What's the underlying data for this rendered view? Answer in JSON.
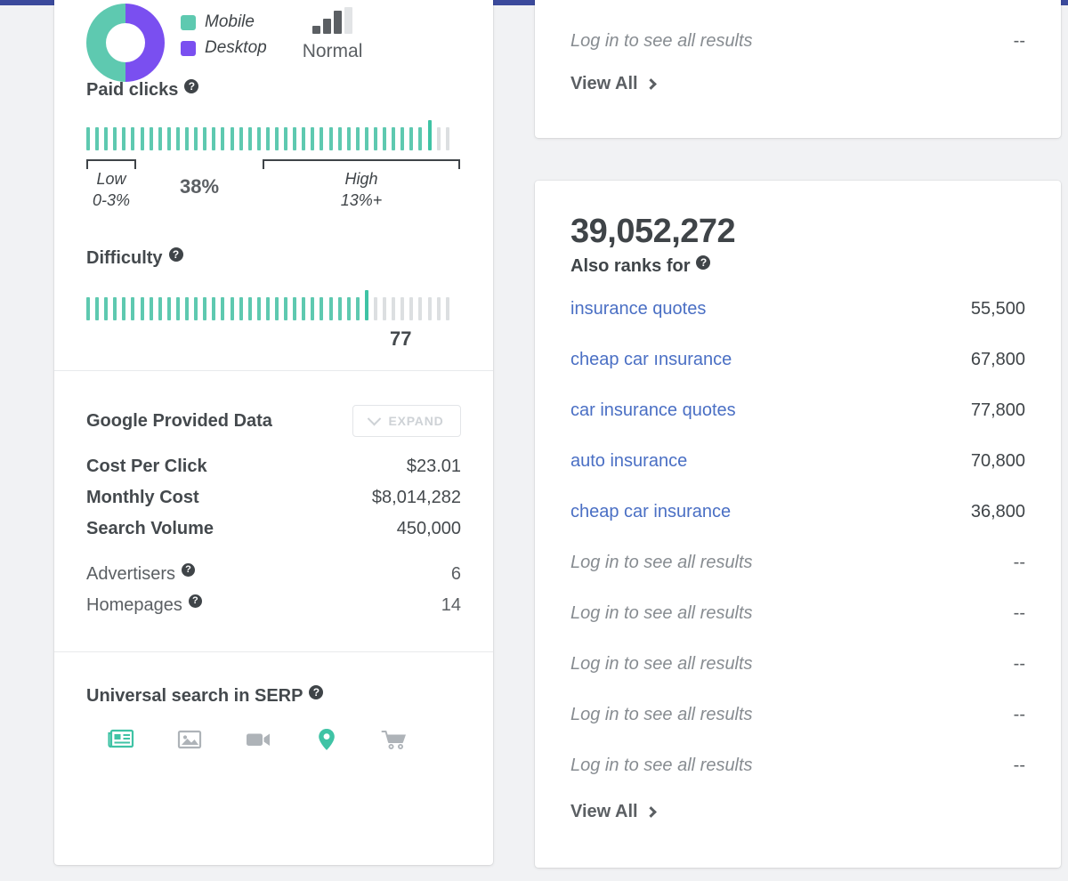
{
  "theme": {
    "topbar_color": "#3b4a9c",
    "accent_teal": "#5ec9b0",
    "accent_purple": "#7a4ff0",
    "link_blue": "#4a6fc4",
    "page_bg": "#f1f2f4"
  },
  "device_split": {
    "legend": [
      {
        "label": "Mobile",
        "color": "#5ec9b0",
        "percent": 50
      },
      {
        "label": "Desktop",
        "color": "#7a4ff0",
        "percent": 50
      }
    ]
  },
  "competition": {
    "label": "Normal",
    "bars_total": 4,
    "bars_filled": 3
  },
  "paid_clicks": {
    "title": "Paid clicks",
    "value": "38%",
    "ticks_total": 41,
    "ticks_filled": 38,
    "low": {
      "label": "Low",
      "range": "0-3%"
    },
    "high": {
      "label": "High",
      "range": "13%+"
    }
  },
  "difficulty": {
    "title": "Difficulty",
    "value": "77",
    "ticks_total": 41,
    "ticks_filled": 31
  },
  "google_provided_data": {
    "title": "Google Provided Data",
    "expand_label": "EXPAND",
    "rows": [
      {
        "key": "Cost Per Click",
        "value": "$23.01"
      },
      {
        "key": "Monthly Cost",
        "value": "$8,014,282"
      },
      {
        "key": "Search Volume",
        "value": "450,000"
      }
    ],
    "secondary_rows": [
      {
        "key": "Advertisers",
        "value": "6",
        "has_help": true
      },
      {
        "key": "Homepages",
        "value": "14",
        "has_help": true
      }
    ]
  },
  "universal_search": {
    "title": "Universal search in SERP",
    "icons": [
      {
        "name": "news-icon",
        "active": true
      },
      {
        "name": "image-icon",
        "active": false
      },
      {
        "name": "video-icon",
        "active": false
      },
      {
        "name": "location-pin-icon",
        "active": true
      },
      {
        "name": "shopping-cart-icon",
        "active": false
      }
    ]
  },
  "top_card": {
    "rows": [
      {
        "label": "Log in to see all results",
        "value": "--",
        "locked": true
      }
    ],
    "view_all_label": "View All"
  },
  "also_ranks": {
    "big_number": "39,052,272",
    "title": "Also ranks for",
    "rows": [
      {
        "label": "insurance quotes",
        "value": "55,500",
        "locked": false
      },
      {
        "label": "cheap car ınsurance",
        "value": "67,800",
        "locked": false
      },
      {
        "label": "car insurance quotes",
        "value": "77,800",
        "locked": false
      },
      {
        "label": "auto insurance",
        "value": "70,800",
        "locked": false
      },
      {
        "label": "cheap car insurance",
        "value": "36,800",
        "locked": false
      },
      {
        "label": "Log in to see all results",
        "value": "--",
        "locked": true
      },
      {
        "label": "Log in to see all results",
        "value": "--",
        "locked": true
      },
      {
        "label": "Log in to see all results",
        "value": "--",
        "locked": true
      },
      {
        "label": "Log in to see all results",
        "value": "--",
        "locked": true
      },
      {
        "label": "Log in to see all results",
        "value": "--",
        "locked": true
      }
    ],
    "view_all_label": "View All"
  }
}
